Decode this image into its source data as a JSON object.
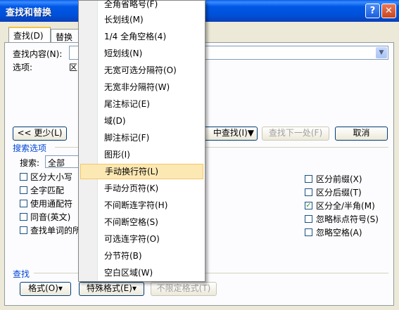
{
  "window": {
    "title": "查找和替换",
    "help_glyph": "?",
    "close_glyph": "✕"
  },
  "tabs": [
    {
      "label": "查找(D)"
    },
    {
      "label": "替换(P)"
    }
  ],
  "find": {
    "find_label": "查找内容(N):",
    "options_label": "选项:",
    "options_value": "区",
    "combo_arrow": "▼"
  },
  "buttons": {
    "less": "<< 更少(L)",
    "find_in": "中查找(I)▼",
    "find_next": "查找下一处(F)",
    "cancel": "取消",
    "format": "格式(O)▾",
    "special": "特殊格式(E)▾",
    "no_format": "不限定格式(T)"
  },
  "search_options": {
    "title": "搜索选项",
    "search_label": "搜索:",
    "search_value": "全部",
    "left_checks": [
      {
        "label": "区分大小写",
        "checked": false
      },
      {
        "label": "全字匹配",
        "checked": false
      },
      {
        "label": "使用通配符",
        "checked": false
      },
      {
        "label": "同音(英文)",
        "checked": false
      },
      {
        "label": "查找单词的所",
        "checked": false
      }
    ],
    "right_checks": [
      {
        "label": "区分前缀(X)",
        "checked": false
      },
      {
        "label": "区分后缀(T)",
        "checked": false
      },
      {
        "label": "区分全/半角(M)",
        "checked": true
      },
      {
        "label": "忽略标点符号(S)",
        "checked": false
      },
      {
        "label": "忽略空格(A)",
        "checked": false
      }
    ]
  },
  "find_section": {
    "title": "查找"
  },
  "menu": {
    "items": [
      {
        "label": "全角省略号(F)",
        "highlighted": false
      },
      {
        "label": "长划线(M)",
        "highlighted": false
      },
      {
        "label": "1/4 全角空格(4)",
        "highlighted": false
      },
      {
        "label": "短划线(N)",
        "highlighted": false
      },
      {
        "label": "无宽可选分隔符(O)",
        "highlighted": false
      },
      {
        "label": "无宽非分隔符(W)",
        "highlighted": false
      },
      {
        "label": "尾注标记(E)",
        "highlighted": false
      },
      {
        "label": "域(D)",
        "highlighted": false
      },
      {
        "label": "脚注标记(F)",
        "highlighted": false
      },
      {
        "label": "图形(I)",
        "highlighted": false
      },
      {
        "label": "手动换行符(L)",
        "highlighted": true
      },
      {
        "label": "手动分页符(K)",
        "highlighted": false
      },
      {
        "label": "不间断连字符(H)",
        "highlighted": false
      },
      {
        "label": "不间断空格(S)",
        "highlighted": false
      },
      {
        "label": "可选连字符(O)",
        "highlighted": false
      },
      {
        "label": "分节符(B)",
        "highlighted": false
      },
      {
        "label": "空白区域(W)",
        "highlighted": false
      }
    ]
  }
}
